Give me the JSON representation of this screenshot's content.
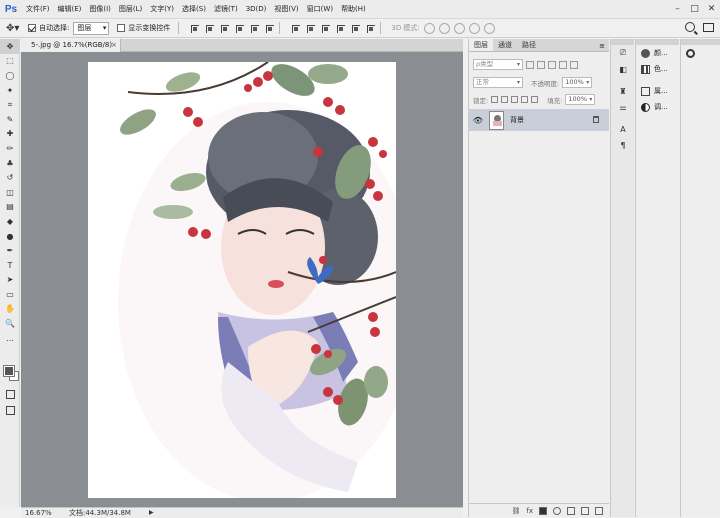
{
  "app": {
    "logo": "Ps",
    "menu": [
      "文件(F)",
      "编辑(E)",
      "图像(I)",
      "图层(L)",
      "文字(Y)",
      "选择(S)",
      "滤镜(T)",
      "3D(D)",
      "视图(V)",
      "窗口(W)",
      "帮助(H)"
    ],
    "window_controls": [
      "–",
      "□",
      "✕"
    ]
  },
  "options_bar": {
    "tool_icon": "move-tool-icon",
    "auto_select_label": "自动选择:",
    "auto_select_checked": true,
    "auto_select_value": "图层",
    "show_transform_label": "显示变换控件",
    "show_transform_checked": false,
    "mode_3d_label": "3D 模式:"
  },
  "document": {
    "tab_title": "5-.jpg @ 16.7%(RGB/8)",
    "tab_close": "×",
    "zoom": "16.67%",
    "doc_info": "文档:44.3M/34.8M",
    "status_arrow": "▶"
  },
  "tools": [
    "move-tool-icon",
    "marquee-tool-icon",
    "lasso-tool-icon",
    "magic-wand-icon",
    "crop-tool-icon",
    "eyedropper-icon",
    "healing-brush-icon",
    "brush-tool-icon",
    "clone-stamp-icon",
    "history-brush-icon",
    "eraser-icon",
    "gradient-tool-icon",
    "blur-tool-icon",
    "dodge-tool-icon",
    "pen-tool-icon",
    "type-tool-icon",
    "path-selection-icon",
    "rectangle-tool-icon",
    "hand-tool-icon",
    "zoom-tool-icon",
    "more-tools-icon"
  ],
  "tool_glyphs": [
    "✥",
    "⬚",
    "◯",
    "✦",
    "⌗",
    "✎",
    "✚",
    "✏",
    "♣",
    "↺",
    "◫",
    "▤",
    "◆",
    "●",
    "✒",
    "T",
    "➤",
    "▭",
    "✋",
    "🔍",
    "…"
  ],
  "colors": {
    "foreground": "#555555",
    "background": "#ffffff",
    "layer_selected": "#c9cfd8",
    "pasteboard": "#8a8d91"
  },
  "layers_panel": {
    "tabs": [
      "图层",
      "通道",
      "路径"
    ],
    "active_tab": 0,
    "filter_kind": "ρ类型",
    "blend_mode": "正常",
    "opacity_label": "不透明度:",
    "opacity_value": "100%",
    "lock_label": "锁定:",
    "fill_label": "填充:",
    "fill_value": "100%",
    "layers": [
      {
        "name": "背景",
        "visible": true,
        "locked": true
      }
    ],
    "bottom_icons": [
      "link-icon",
      "fx-icon",
      "mask-icon",
      "adjustment-icon",
      "group-icon",
      "new-layer-icon",
      "trash-icon"
    ],
    "bottom_labels": [
      "⛓",
      "fx"
    ]
  },
  "dock": {
    "col1_icons": [
      "history-icon",
      "properties-icon",
      "brush-preset-icon",
      "adjustments-icon",
      "character-icon",
      "paragraph-icon"
    ],
    "col1_glyphs": [
      "⎚",
      "◧",
      "♜",
      "⚌",
      "A",
      "¶"
    ],
    "col2": [
      {
        "icon": "color-palette-icon",
        "label": "颜..."
      },
      {
        "icon": "swatches-icon",
        "label": "色..."
      },
      {
        "icon": "adjustments-panel-icon",
        "label": "属..."
      },
      {
        "icon": "styles-icon",
        "label": "调..."
      }
    ],
    "col3_icon": "3d-panel-icon"
  }
}
